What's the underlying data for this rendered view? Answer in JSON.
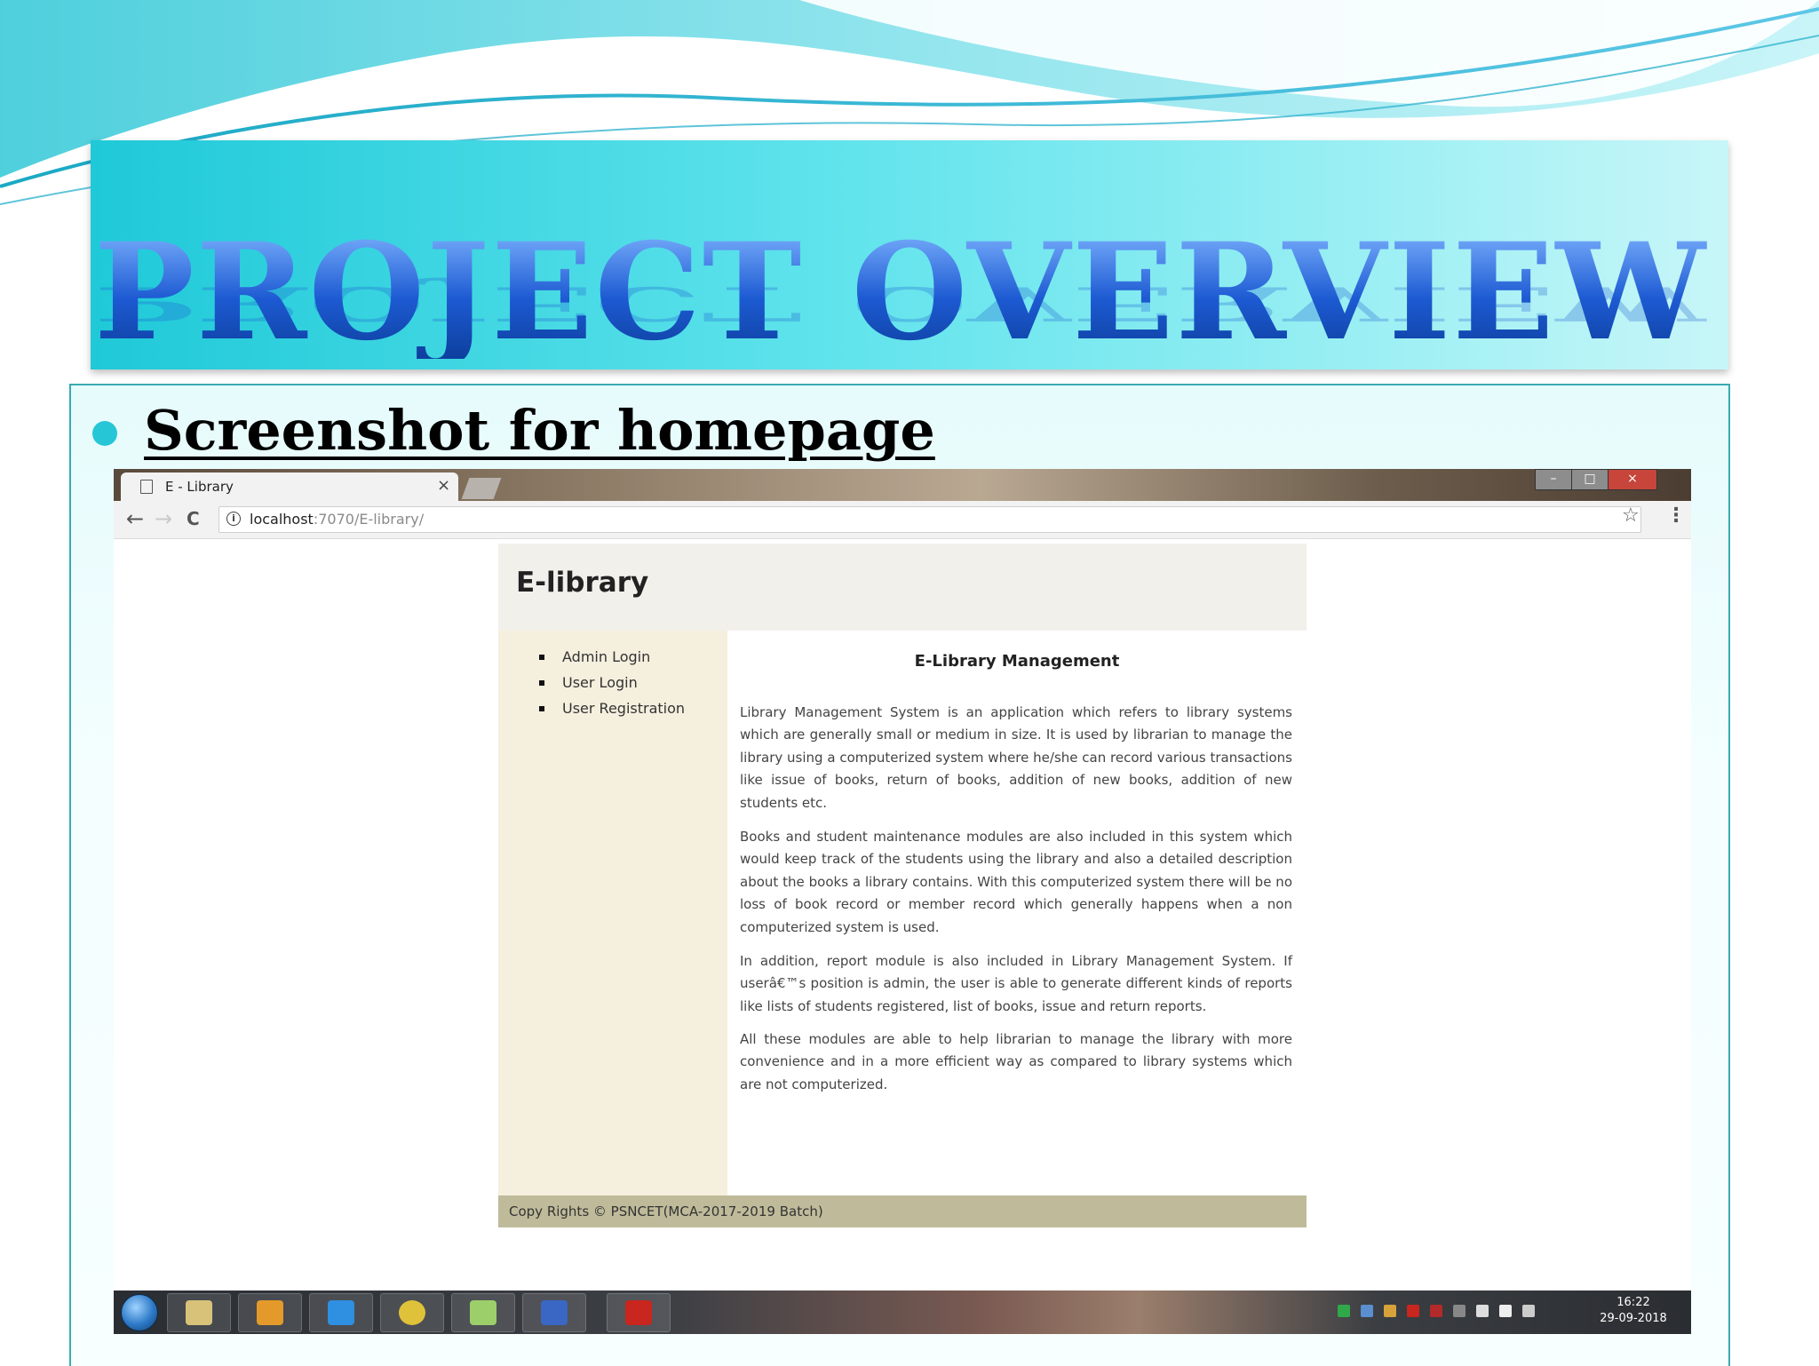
{
  "slide": {
    "title": "PROJECT OVERVIEW",
    "heading": "Screenshot for homepage"
  },
  "browser": {
    "tab_title": "E - Library",
    "tab_close": "×",
    "window_controls": {
      "minimize": "–",
      "maximize": "□",
      "close": "×"
    },
    "nav": {
      "back": "←",
      "forward": "→",
      "reload": "C"
    },
    "url_host": "localhost",
    "url_path": ":7070/E-library/",
    "star": "☆",
    "menu": "⋮"
  },
  "page": {
    "site_title": "E-library",
    "menu": [
      {
        "label": "Admin Login"
      },
      {
        "label": "User Login"
      },
      {
        "label": "User Registration"
      }
    ],
    "main_title": "E-Library Management",
    "paragraphs": [
      "Library Management System is an application which refers to library systems which are generally small or medium in size. It is used by librarian to manage the library using a computerized system where he/she can record various transactions like issue of books, return of books, addition of new books, addition of new students etc.",
      "Books and student maintenance modules are also included in this system which would keep track of the students using the library and also a detailed description about the books a library contains. With this computerized system there will be no loss of book record or member record which generally happens when a non computerized system is used.",
      "In addition, report module is also included in Library Management System. If userâ€™s position is admin, the user is able to generate different kinds of reports like lists of students registered, list of books, issue and return reports.",
      "All these modules are able to help librarian to manage the library with more convenience and in a more efficient way as compared to library systems which are not computerized."
    ],
    "footer": "Copy Rights © PSNCET(MCA-2017-2019 Batch)"
  },
  "taskbar": {
    "time": "16:22",
    "date": "29-09-2018",
    "colors": {
      "explorer": "#d8c27a",
      "media": "#e39a2a",
      "ie": "#2f8fe0",
      "chrome": "#e0c13a",
      "folder": "#9ccf6a",
      "word": "#3a67c4",
      "pdf": "#c8261f"
    }
  },
  "colors": {
    "accent_cyan": "#26c6d6",
    "title_blue": "#1f5fd6",
    "sidebar_bg": "#f5efde",
    "footer_bg": "#bfbb9a"
  }
}
